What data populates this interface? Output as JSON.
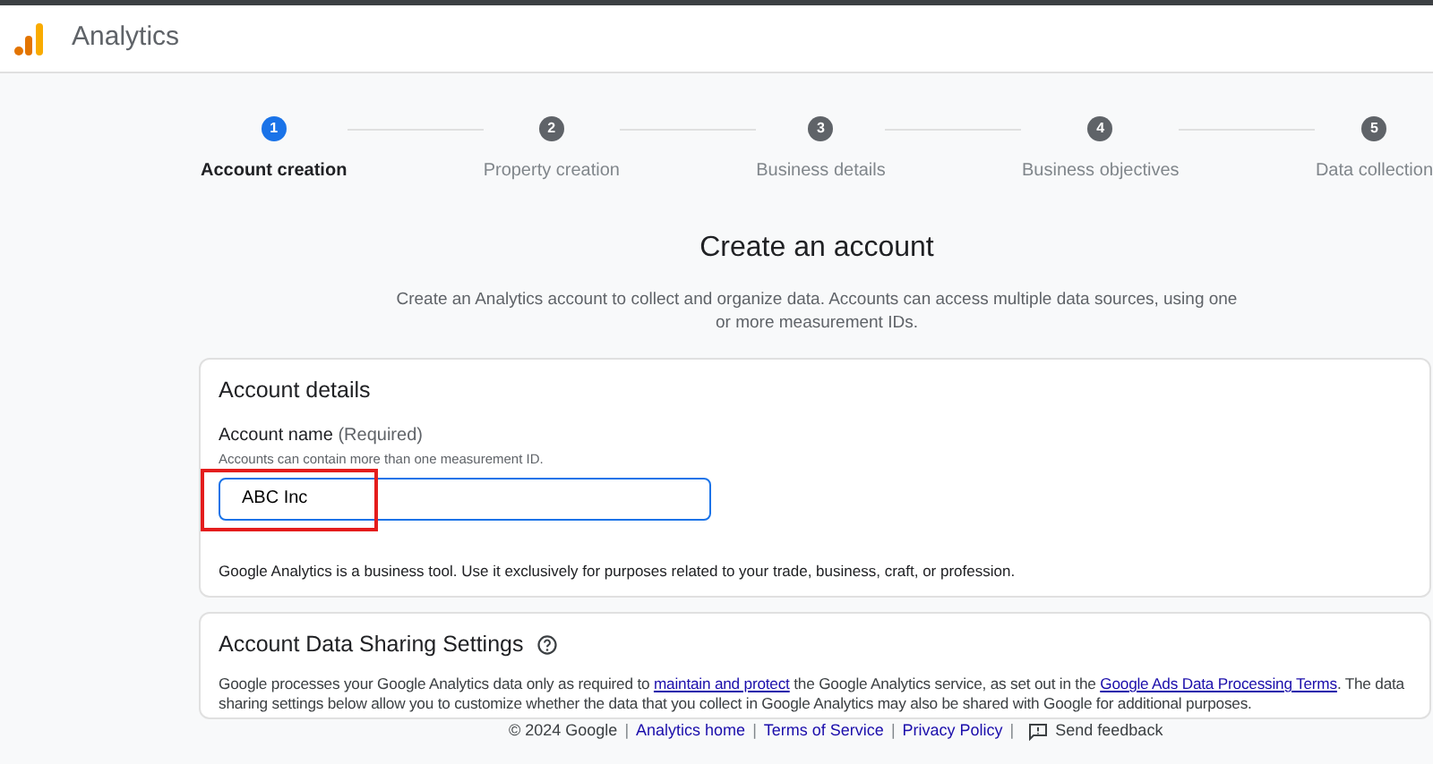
{
  "app": {
    "title": "Analytics"
  },
  "steps": [
    {
      "number": "1",
      "label": "Account creation",
      "selected": true
    },
    {
      "number": "2",
      "label": "Property creation",
      "selected": false
    },
    {
      "number": "3",
      "label": "Business details",
      "selected": false
    },
    {
      "number": "4",
      "label": "Business objectives",
      "selected": false
    },
    {
      "number": "5",
      "label": "Data collection",
      "selected": false
    }
  ],
  "heading": "Create an account",
  "description": "Create an Analytics account to collect and organize data. Accounts can access multiple data sources, using one or more measurement IDs.",
  "account_details": {
    "title": "Account details",
    "field_label": "Account name",
    "field_required": "(Required)",
    "field_hint": "Accounts can contain more than one measurement ID.",
    "value": "ABC Inc",
    "highlighted": true,
    "note": "Google Analytics is a business tool. Use it exclusively for purposes related to your trade, business, craft, or profession."
  },
  "sharing": {
    "title": "Account Data Sharing Settings",
    "text": [
      {
        "kind": "text",
        "text": "Google processes your Google Analytics data only as required to "
      },
      {
        "kind": "link",
        "text": "maintain and protect"
      },
      {
        "kind": "text",
        "text": " the Google Analytics service, as set out in the "
      },
      {
        "kind": "link",
        "text": "Google Ads Data Processing Terms"
      },
      {
        "kind": "text",
        "text": ". The data sharing settings below allow you to customize whether the data that you collect in Google Analytics may also be shared with Google for additional purposes."
      }
    ]
  },
  "footer": [
    {
      "kind": "text",
      "text": "© 2024 Google"
    },
    {
      "kind": "separator",
      "text": "|"
    },
    {
      "kind": "link",
      "text": "Analytics home"
    },
    {
      "kind": "separator",
      "text": "|"
    },
    {
      "kind": "link",
      "text": "Terms of Service"
    },
    {
      "kind": "separator",
      "text": "|"
    },
    {
      "kind": "link",
      "text": "Privacy Policy"
    },
    {
      "kind": "separator",
      "text": "|"
    },
    {
      "kind": "feedback",
      "text": "Send feedback"
    }
  ]
}
